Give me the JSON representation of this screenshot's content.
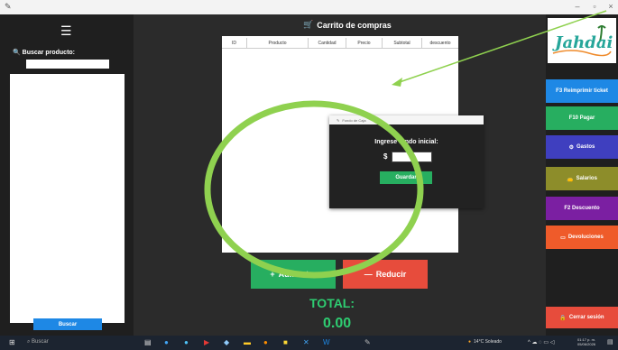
{
  "left_panel": {
    "search_label": "Buscar producto:",
    "search_value": "",
    "search_button": "Buscar"
  },
  "cart": {
    "title": "Carrito de compras",
    "columns": [
      "ID",
      "Producto",
      "Cantidad",
      "Precio",
      "Subtotal",
      "descuento"
    ]
  },
  "dialog": {
    "title": "Fondo de Caja",
    "label": "Ingrese fondo inicial:",
    "currency": "$",
    "value": "",
    "save": "Guardar"
  },
  "actions": {
    "increase": "Aumentar",
    "decrease": "Reducir"
  },
  "total": {
    "label": "TOTAL:",
    "value": "0.00"
  },
  "right_panel": {
    "logo": "Jahdai",
    "buttons": [
      {
        "label": "F3 Reimprimir ticket",
        "color": "#1e88e5"
      },
      {
        "label": "F10 Pagar",
        "color": "#27ae60"
      },
      {
        "label": "Gastos",
        "color": "#3f3fbf"
      },
      {
        "label": "Salarios",
        "color": "#8d8d2a"
      },
      {
        "label": "F2 Descuento",
        "color": "#7b1fa2"
      },
      {
        "label": "Devoluciones",
        "color": "#ef5b2a"
      },
      {
        "label": "Cerrar sesión",
        "color": "#e74c3c"
      }
    ]
  },
  "taskbar": {
    "search": "Buscar",
    "weather": "14°C  Soleado",
    "time": "01:17 p. m.",
    "date": "05/06/2026"
  },
  "colors": {
    "background": "#2b2b2b",
    "panel": "#1f1f1f",
    "annotation": "#8fd14f",
    "total": "#2ecc71"
  }
}
